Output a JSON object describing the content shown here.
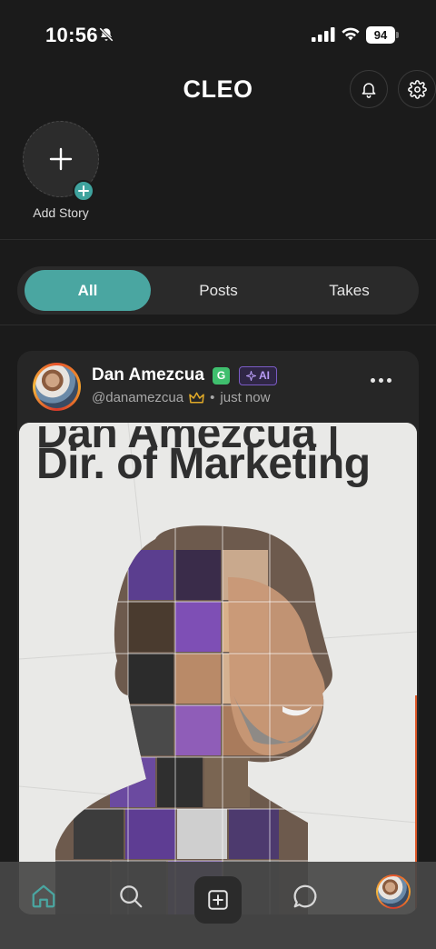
{
  "status_bar": {
    "time": "10:56",
    "battery": "94"
  },
  "header": {
    "title": "CLEO"
  },
  "stories": {
    "add_label": "Add Story"
  },
  "tabs": [
    {
      "label": "All",
      "active": true
    },
    {
      "label": "Posts",
      "active": false
    },
    {
      "label": "Takes",
      "active": false
    }
  ],
  "post": {
    "author_name": "Dan Amezcua",
    "badge_g": "G",
    "badge_ai": "AI",
    "handle": "@danamezcua",
    "separator": "•",
    "time": "just now",
    "image_headline_line1": "Dan Amezcua |",
    "image_headline_line2": "Dir. of Marketing"
  },
  "colors": {
    "accent": "#4aa6a1",
    "background": "#1b1b1b",
    "card": "#262626",
    "ai_badge": "#b89cf5",
    "verified_badge": "#3fbf6e"
  },
  "icons": {
    "status": [
      "bell-slash-icon",
      "signal-icon",
      "wifi-icon",
      "battery-icon"
    ],
    "header": [
      "bell-icon",
      "gear-icon"
    ],
    "nav": [
      "home-icon",
      "search-icon",
      "plus-square-icon",
      "chat-bubble-icon",
      "profile-avatar"
    ]
  }
}
